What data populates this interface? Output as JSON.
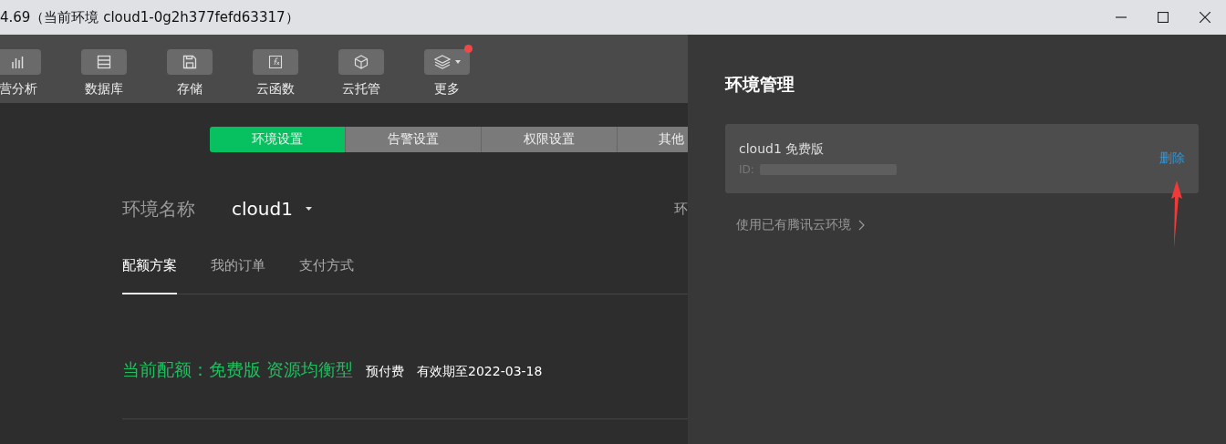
{
  "window": {
    "title": "4.69（当前环境 cloud1-0g2h377fefd63317）"
  },
  "toolbar": [
    {
      "label": "营分析",
      "dot": false
    },
    {
      "label": "数据库",
      "dot": false
    },
    {
      "label": "存储",
      "dot": false
    },
    {
      "label": "云函数",
      "dot": false
    },
    {
      "label": "云托管",
      "dot": false
    },
    {
      "label": "更多",
      "dot": true
    }
  ],
  "tabs": [
    {
      "label": "环境设置",
      "selected": true
    },
    {
      "label": "告警设置",
      "selected": false
    },
    {
      "label": "权限设置",
      "selected": false
    },
    {
      "label": "其他",
      "selected": false
    }
  ],
  "env_name": {
    "label": "环境名称",
    "value": "cloud1",
    "side_label": "环"
  },
  "sub_tabs": [
    {
      "label": "配额方案",
      "selected": true
    },
    {
      "label": "我的订单",
      "selected": false
    },
    {
      "label": "支付方式",
      "selected": false
    }
  ],
  "quota": {
    "title": "当前配额：免费版 资源均衡型",
    "billing": "预付费",
    "expiry": "有效期至2022-03-18"
  },
  "panel": {
    "title": "环境管理",
    "environments": [
      {
        "name": "cloud1 免费版",
        "id_label": "ID:",
        "action": "删除"
      }
    ],
    "link": "使用已有腾讯云环境"
  }
}
